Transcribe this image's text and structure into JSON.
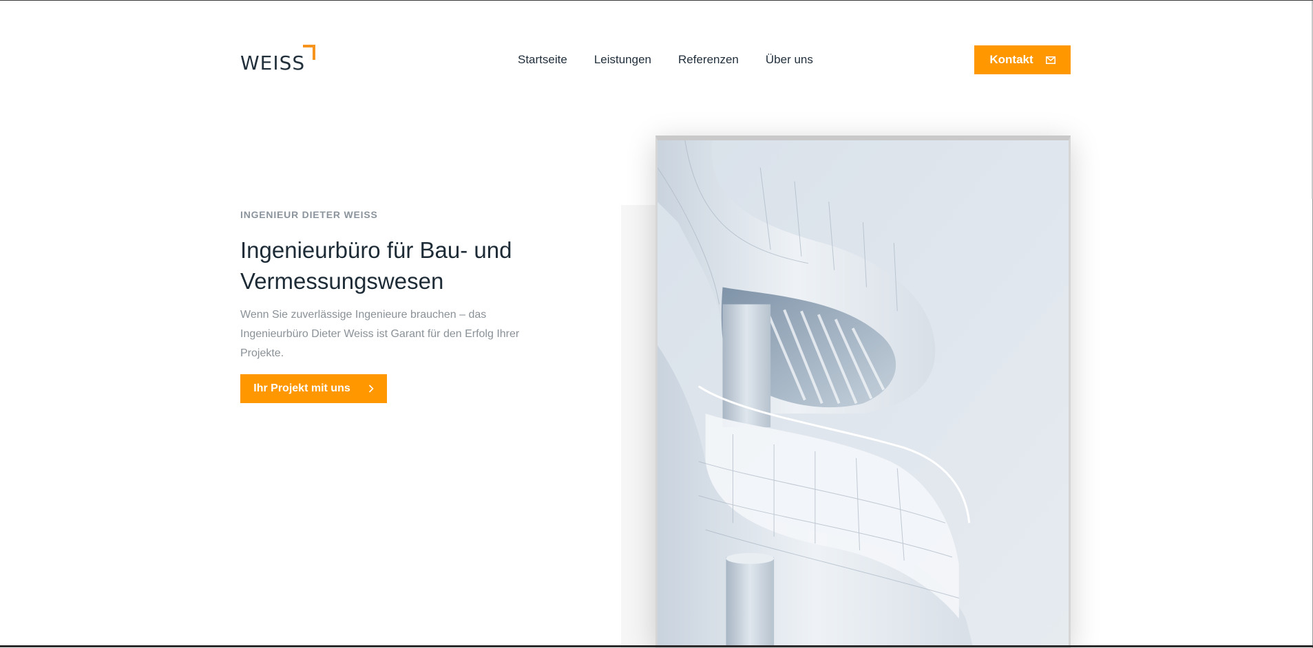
{
  "logo": {
    "text": "WEISS"
  },
  "nav": {
    "items": [
      {
        "label": "Startseite"
      },
      {
        "label": "Leistungen"
      },
      {
        "label": "Referenzen"
      },
      {
        "label": "Über uns"
      }
    ]
  },
  "header": {
    "contact_label": "Kontakt",
    "contact_icon": "mail-icon"
  },
  "hero": {
    "eyebrow": "INGENIEUR DIETER WEISS",
    "title": "Ingenieurbüro für Bau- und Vermessungswesen",
    "text": "Wenn Sie zuverlässige Ingenieure brauchen – das Ingenieurbüro Dieter Weiss ist Garant für den Erfolg Ihrer Projekte.",
    "cta_label": "Ihr Projekt mit uns",
    "cta_icon": "chevron-right-icon"
  },
  "colors": {
    "accent": "#ff9800",
    "heading": "#1d2b36",
    "muted": "#8a9197"
  }
}
